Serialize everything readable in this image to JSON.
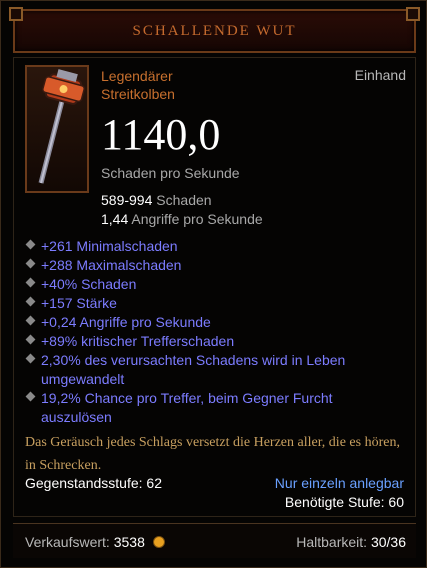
{
  "title": "SCHALLENDE WUT",
  "item": {
    "rarity_line1": "Legendärer",
    "rarity_line2": "Streitkolben",
    "slot": "Einhand",
    "dps": "1140,0",
    "dps_label": "Schaden pro Sekunde",
    "damage_value": "589-994",
    "damage_label": "Schaden",
    "aps_value": "1,44",
    "aps_label": "Angriffe pro Sekunde"
  },
  "affixes": [
    "+261 Minimalschaden",
    "+288 Maximalschaden",
    "+40% Schaden",
    "+157 Stärke",
    "+0,24 Angriffe pro Sekunde",
    "+89% kritischer Trefferschaden",
    "2,30% des verursachten Schadens wird in Leben umgewandelt",
    "19,2% Chance pro Treffer, beim Gegner Furcht auszulösen"
  ],
  "flavor": "Das Geräusch jedes Schlags versetzt die Herzen aller, die es hören, in Schrecken.",
  "item_level": "Gegenstandsstufe: 62",
  "bind": "Nur einzeln anlegbar",
  "required_level": "Benötigte Stufe: 60",
  "footer": {
    "sell_label": "Verkaufswert:",
    "sell_value": "3538",
    "durability_label": "Haltbarkeit:",
    "durability_value": "30/36"
  },
  "colors": {
    "legendary": "#c8702e",
    "affix": "#7c7cff",
    "flavor": "#c8a060"
  },
  "icons": [
    "mace-icon",
    "gold-coin-icon"
  ]
}
